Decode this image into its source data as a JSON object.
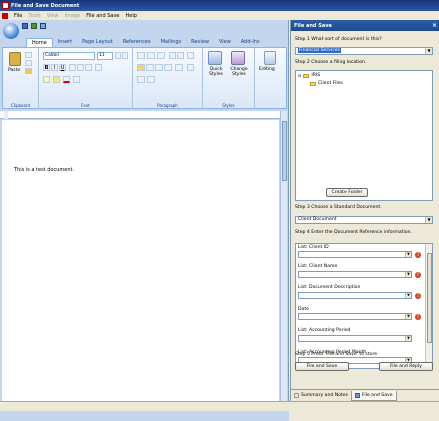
{
  "window": {
    "title": "File and Save Document"
  },
  "menu": [
    {
      "label": "File",
      "enabled": true
    },
    {
      "label": "Tools",
      "enabled": false
    },
    {
      "label": "View",
      "enabled": false
    },
    {
      "label": "Image",
      "enabled": false
    },
    {
      "label": "File and Save",
      "enabled": true
    },
    {
      "label": "Help",
      "enabled": true
    }
  ],
  "ribbon": {
    "tabs": [
      "Home",
      "Insert",
      "Page Layout",
      "References",
      "Mailings",
      "Review",
      "View",
      "Add-Ins"
    ],
    "active_tab": "Home",
    "groups": [
      "Clipboard",
      "Font",
      "Paragraph",
      "Styles"
    ],
    "paste_label": "Paste",
    "font_name": "Calibri",
    "font_size": "11",
    "quick_styles_label": "Quick Styles",
    "change_styles_label": "Change Styles",
    "editing_label": "Editing"
  },
  "document": {
    "text": "This is a test document."
  },
  "pane": {
    "title": "File and Save",
    "close": "×",
    "step1": "Step 1 What sort of document is this?",
    "doc_type": "Financial Services",
    "step2": "Step 2 Choose a filing location.",
    "tree": [
      {
        "label": "IRIS"
      },
      {
        "label": "Client Files"
      }
    ],
    "create_folder": "Create Folder",
    "step3": "Step 3 Choose a Standard Document.",
    "standard_doc": "Client Document",
    "step4": "Step 4 Enter the Document Reference information.",
    "fields": [
      {
        "label": "List: Client ID",
        "error": true
      },
      {
        "label": "List: Client Name",
        "error": true
      },
      {
        "label": "List: Document Description",
        "error": true
      },
      {
        "label": "Date",
        "error": true
      },
      {
        "label": "List: Accounting Period",
        "error": false
      },
      {
        "label": "List: Accounting Period Month",
        "error": false
      }
    ],
    "step5": "Step 5 Press 'File and Save' to store",
    "file_and_save_button": "File and Save",
    "file_and_reply_button": "File and Reply",
    "bottom_tabs": [
      "Summary and Notes",
      "File and Save"
    ],
    "active_bottom_tab": "File and Save"
  }
}
